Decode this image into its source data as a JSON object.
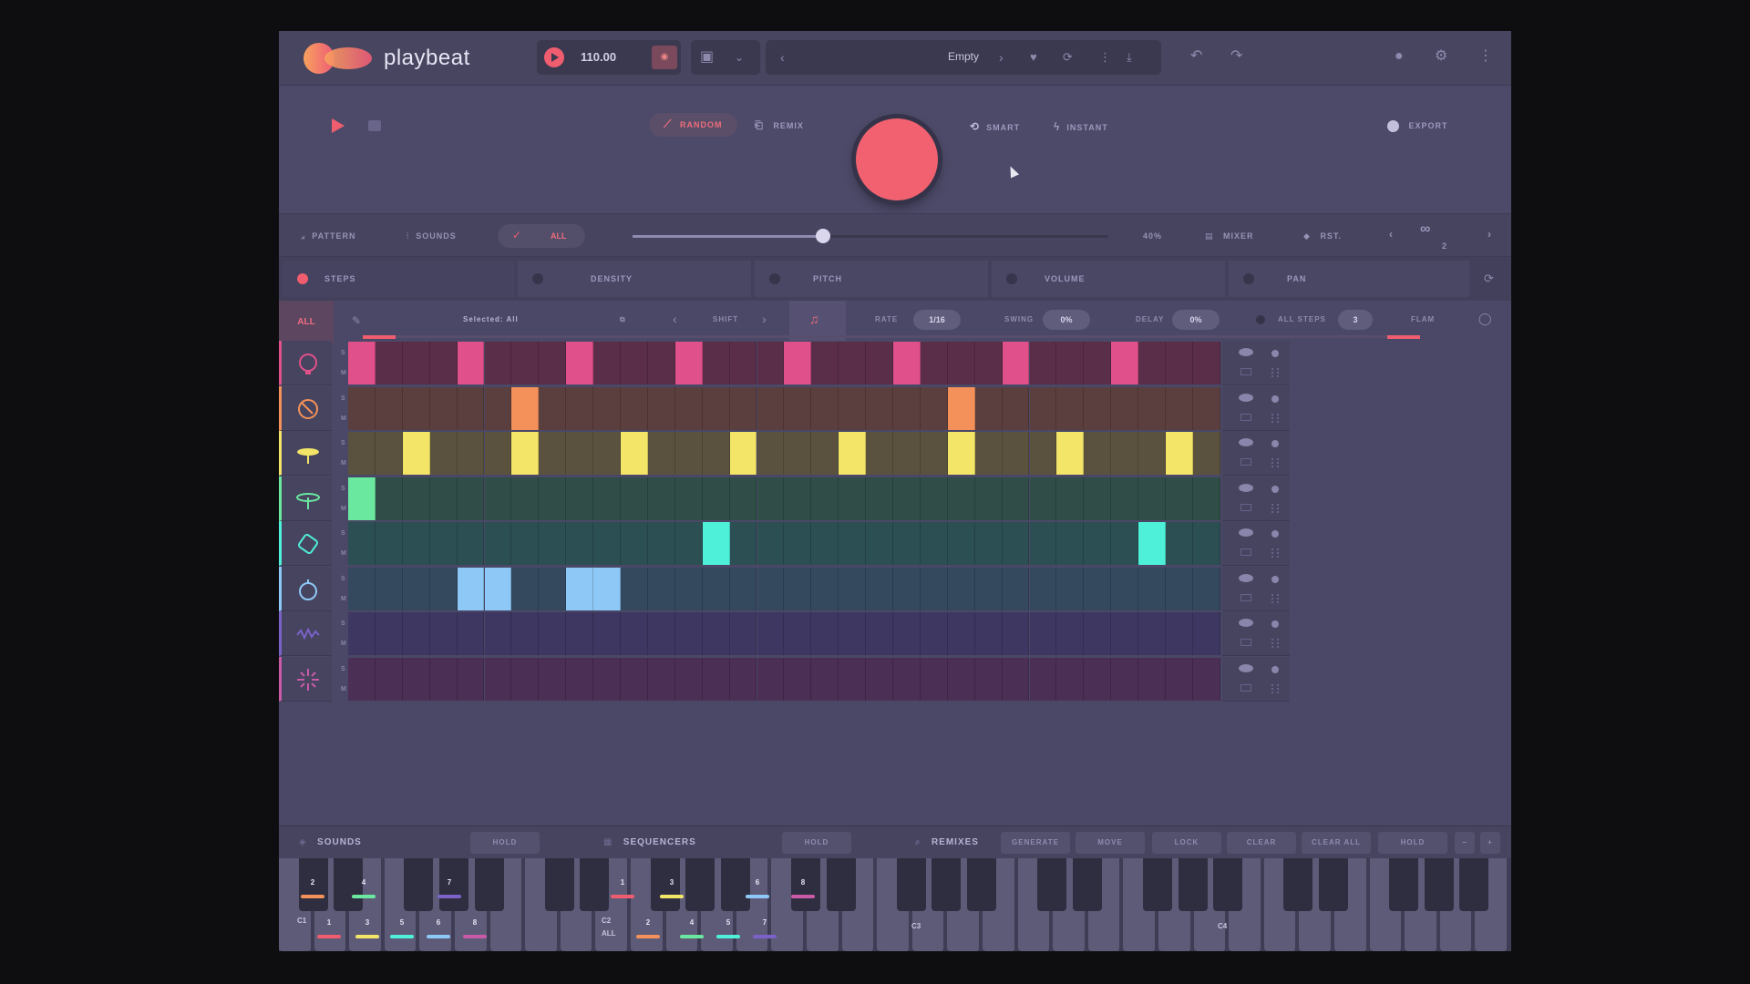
{
  "app": {
    "name": "playbeat"
  },
  "header": {
    "tempo": "110.00",
    "preset": "Empty"
  },
  "transport": {
    "random": "RANDOM",
    "remix": "REMIX",
    "smart": "SMART",
    "instant": "INSTANT",
    "export": "EXPORT"
  },
  "controls": {
    "pattern": "PATTERN",
    "sounds": "SOUNDS",
    "all": "ALL",
    "amount_value": "40%",
    "amount_level": 0.4,
    "mixer": "MIXER",
    "rst": "RST.",
    "loop_count": "2"
  },
  "params": {
    "steps": "STEPS",
    "density": "DENSITY",
    "pitch": "PITCH",
    "volume": "VOLUME",
    "pan": "PAN"
  },
  "selection": {
    "all": "ALL",
    "selected": "Selected: All",
    "shift": "SHIFT",
    "rate_label": "RATE",
    "rate": "1/16",
    "swing_label": "SWING",
    "swing": "0%",
    "delay_label": "DELAY",
    "delay": "0%",
    "all_steps": "ALL STEPS",
    "steps_value": "3",
    "flam": "FLAM"
  },
  "tracks": [
    {
      "icon": "kick-icon",
      "color": "#e0508a",
      "bg": "#5a2e49",
      "steps": [
        0,
        4,
        8,
        12,
        16,
        20,
        24,
        28
      ]
    },
    {
      "icon": "snare-icon",
      "color": "#f4915a",
      "bg": "#5b3f3e",
      "steps": [
        6,
        22
      ]
    },
    {
      "icon": "closed-hihat-icon",
      "color": "#f3e568",
      "bg": "#5a523f",
      "steps": [
        2,
        6,
        10,
        14,
        18,
        22,
        26,
        30
      ]
    },
    {
      "icon": "open-hihat-icon",
      "color": "#6be8a0",
      "bg": "#304d48",
      "steps": [
        0
      ]
    },
    {
      "icon": "clap-icon",
      "color": "#4ff0d9",
      "bg": "#2c4f54",
      "steps": [
        13,
        29
      ]
    },
    {
      "icon": "tom-icon",
      "color": "#8ec8f6",
      "bg": "#34485e",
      "steps": [
        4,
        5,
        8,
        9
      ]
    },
    {
      "icon": "wave-icon",
      "color": "#7a62c8",
      "bg": "#3d3762",
      "steps": []
    },
    {
      "icon": "fx-sparkle-icon",
      "color": "#c85aa8",
      "bg": "#4b2f55",
      "steps": []
    }
  ],
  "bottom": {
    "sounds": "SOUNDS",
    "hold1": "HOLD",
    "sequencers": "SEQUENCERS",
    "hold2": "HOLD",
    "remixes": "REMIXES",
    "generate": "GENERATE",
    "move": "MOVE",
    "lock": "LOCK",
    "clear": "CLEAR",
    "clear_all": "CLEAR ALL",
    "hold3": "HOLD"
  },
  "keyboard": {
    "c1": "C1",
    "c2": "C2",
    "c3": "C3",
    "c4": "C4",
    "all": "ALL",
    "group1_top": [
      "2",
      "4",
      "7"
    ],
    "group1_bottom": [
      "1",
      "3",
      "5",
      "6",
      "8"
    ],
    "group2_top": [
      "1",
      "3",
      "6",
      "8"
    ],
    "group2_bottom": [
      "2",
      "4",
      "5",
      "7"
    ]
  },
  "colors": {
    "accent": "#ef5d6f",
    "panel": "#4a4866"
  }
}
